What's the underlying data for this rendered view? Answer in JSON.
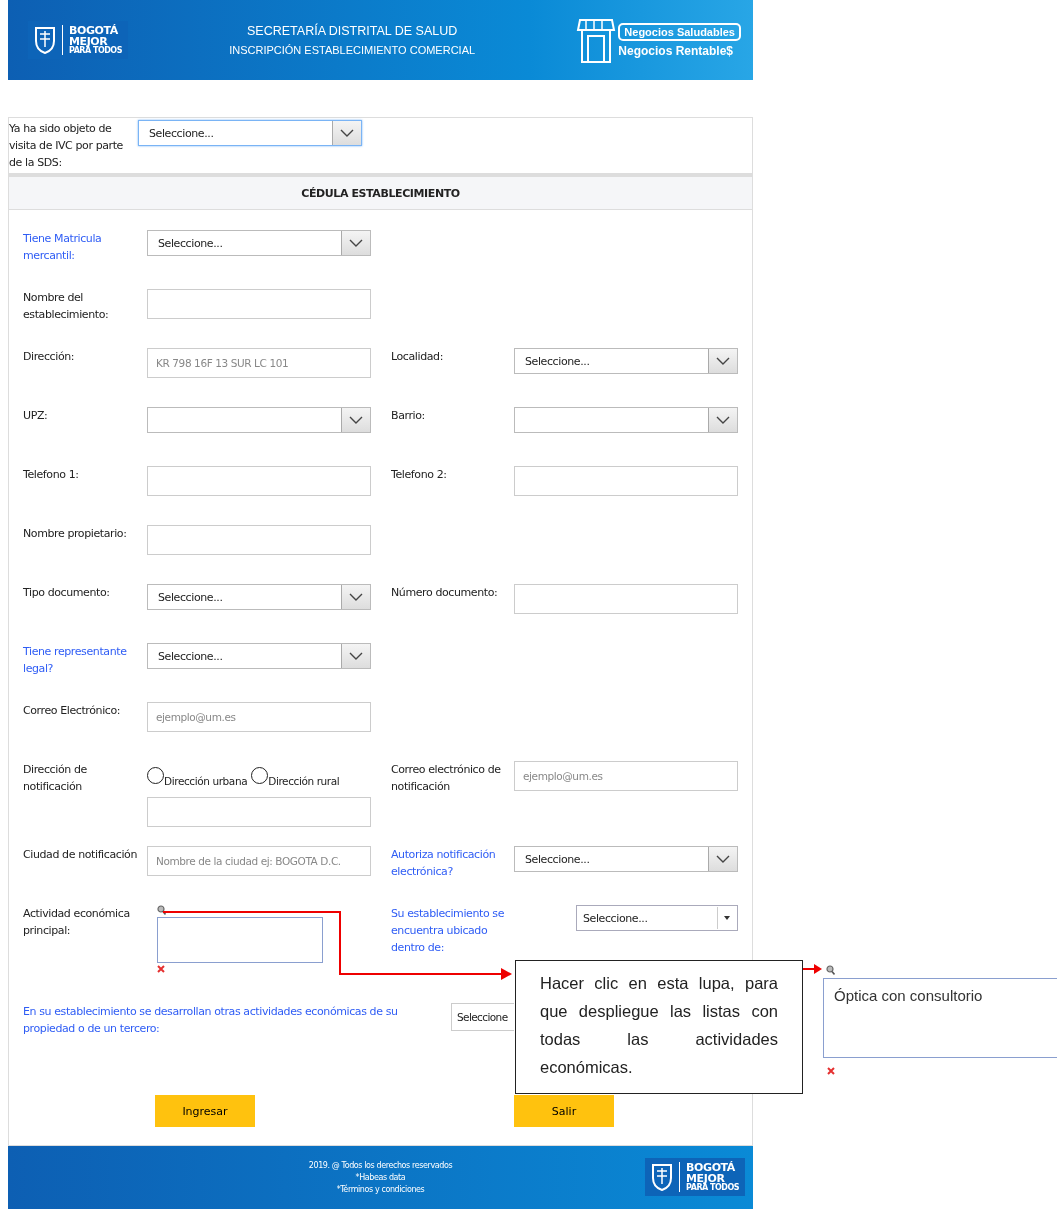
{
  "header": {
    "title": "SECRETARÍA DISTRITAL DE SALUD",
    "subtitle": "INSCRIPCIÓN ESTABLECIMIENTO COMERCIAL",
    "logo_lines": [
      "BOGOTÁ",
      "MEJOR",
      "PARA TODOS"
    ],
    "badge_lines": [
      "Negocios Saludables",
      "Negocios Rentable$"
    ]
  },
  "ivc": {
    "label": "Ya ha sido objeto de visita de IVC por parte de la SDS:",
    "control": {
      "kind": "select",
      "value": "Seleccione...",
      "focused": true
    }
  },
  "section_title": "CÉDULA ESTABLECIMIENTO",
  "rows": [
    {
      "cells": [
        {
          "label": "Tiene Matricula mercantil:",
          "highlighted": true,
          "control": {
            "kind": "select",
            "value": "Seleccione..."
          }
        }
      ]
    },
    {
      "cells": [
        {
          "label": "Nombre del establecimiento:",
          "highlighted": false,
          "control": {
            "kind": "text"
          }
        }
      ]
    },
    {
      "cells": [
        {
          "label": "Dirección:",
          "highlighted": false,
          "control": {
            "kind": "text",
            "placeholder": "KR 798 16F 13 SUR LC 101"
          }
        },
        {
          "label": "Localidad:",
          "highlighted": false,
          "control": {
            "kind": "select",
            "value": "Seleccione..."
          }
        }
      ]
    },
    {
      "cells": [
        {
          "label": "UPZ:",
          "highlighted": false,
          "control": {
            "kind": "select"
          }
        },
        {
          "label": "Barrio:",
          "highlighted": false,
          "control": {
            "kind": "select"
          }
        }
      ]
    },
    {
      "cells": [
        {
          "label": "Telefono 1:",
          "highlighted": false,
          "control": {
            "kind": "text"
          }
        },
        {
          "label": "Telefono 2:",
          "highlighted": false,
          "control": {
            "kind": "text"
          }
        }
      ]
    },
    {
      "cells": [
        {
          "label": "Nombre propietario:",
          "highlighted": false,
          "control": {
            "kind": "text"
          }
        }
      ]
    },
    {
      "cells": [
        {
          "label": "Tipo documento:",
          "highlighted": false,
          "control": {
            "kind": "select",
            "value": "Seleccione..."
          }
        },
        {
          "label": "Número documento:",
          "highlighted": false,
          "control": {
            "kind": "text"
          }
        }
      ]
    },
    {
      "cells": [
        {
          "label": "Tiene representante legal?",
          "highlighted": true,
          "control": {
            "kind": "select",
            "value": "Seleccione..."
          }
        }
      ]
    },
    {
      "cells": [
        {
          "label": "Correo Electrónico:",
          "highlighted": false,
          "control": {
            "kind": "text",
            "placeholder": "ejemplo@um.es"
          }
        }
      ]
    },
    {
      "cells": [
        {
          "label": "Dirección de notificación",
          "highlighted": false,
          "control": {
            "kind": "radio",
            "options": [
              {
                "label": "Dirección urbana",
                "selected": false
              },
              {
                "label": "Dirección rural",
                "selected": false
              }
            ]
          }
        },
        {
          "label": "Correo electrónico de notificación",
          "highlighted": false,
          "control": {
            "kind": "text",
            "placeholder": "ejemplo@um.es"
          }
        }
      ]
    },
    {
      "cells": [
        {
          "label": "Ciudad de notificación",
          "highlighted": false,
          "control": {
            "kind": "text",
            "placeholder": "Nombre de la ciudad ej: BOGOTA D.C."
          }
        },
        {
          "label": "Autoriza notificación electrónica?",
          "highlighted": true,
          "control": {
            "kind": "select",
            "value": "Seleccione..."
          }
        }
      ]
    },
    {
      "cells": [
        {
          "label": "Actividad económica principal:",
          "highlighted": false,
          "control": {
            "kind": "search"
          }
        },
        {
          "label": "Su establecimiento se encuentra ubicado dentro de:",
          "highlighted": true,
          "control": {
            "kind": "dropdown",
            "value": "Seleccione..."
          }
        }
      ]
    }
  ],
  "other_activities": {
    "label": "En su establecimiento se desarrollan otras actividades económicas de su propiedad o de un tercero:",
    "highlighted": true,
    "value": "Seleccione"
  },
  "buttons": [
    "Ingresar",
    "Salir"
  ],
  "footer": {
    "lines": [
      "2019. @ Todos los derechos reservados",
      "*Habeas data",
      "*Términos y condiciones"
    ],
    "logo_lines": [
      "BOGOTÁ",
      "MEJOR",
      "PARA TODOS"
    ]
  },
  "annotation": {
    "callout": "Hacer clic en esta lupa, para que despliegue las listas con todas las actividades económicas.",
    "example_value": "Óptica con consultorio"
  }
}
